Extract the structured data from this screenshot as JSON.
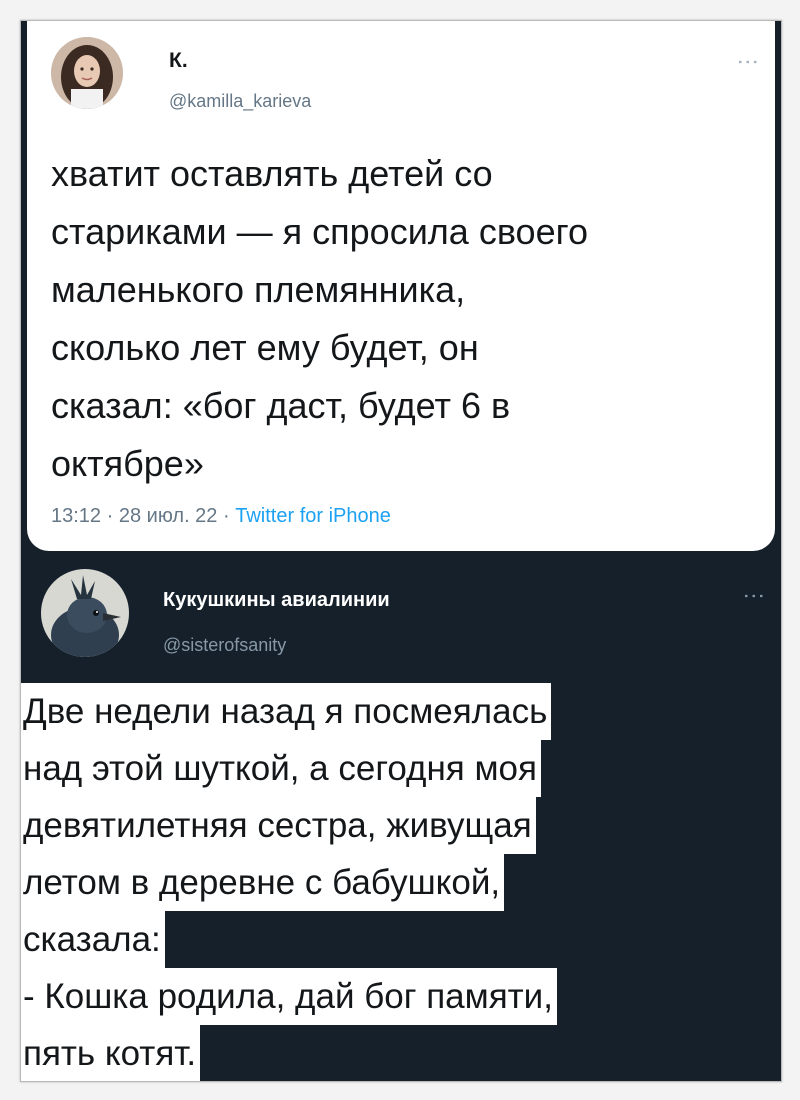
{
  "top_tweet": {
    "name": "К.",
    "handle": "@kamilla_karieva",
    "text": "хватит оставлять детей со\nстариками — я спросила своего\nмаленького племянника,\nсколько лет ему будет, он\nсказал: «бог даст, будет 6 в\nоктябре»",
    "time": "13:12",
    "date": "28 июл. 22",
    "source": "Twitter for iPhone",
    "separator": "·",
    "avatar_icon": "woman-portrait-avatar",
    "more_icon": "more-options-icon"
  },
  "reply_tweet": {
    "name": "Кукушкины авиалинии",
    "handle": "@sisterofsanity",
    "lines": [
      "Две недели назад я посмеялась",
      "над этой шуткой, а сегодня моя",
      "девятилетняя сестра, живущая",
      "летом в деревне с бабушкой,",
      "сказала:",
      "- Кошка родила, дай бог памяти,",
      "пять котят."
    ],
    "avatar_icon": "crested-bird-avatar",
    "more_icon": "more-options-icon"
  },
  "colors": {
    "dark_bg": "#15202b",
    "light_bg": "#ffffff",
    "link_blue": "#1da1f2",
    "muted_gray": "#657786"
  }
}
